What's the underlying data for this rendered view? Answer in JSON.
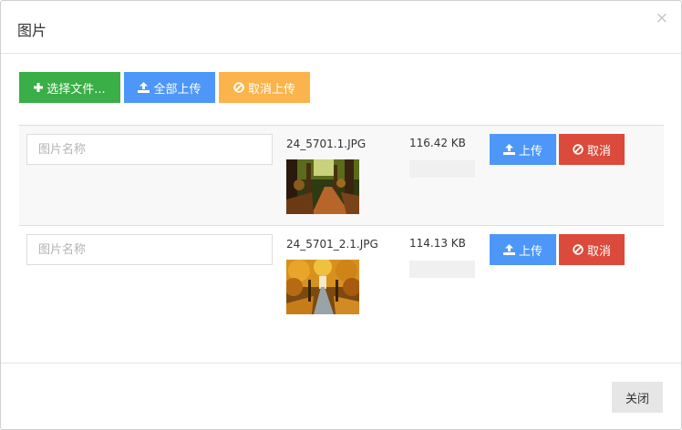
{
  "dialog": {
    "title": "图片",
    "close_symbol": "×"
  },
  "toolbar": {
    "select_files": {
      "label": "选择文件...",
      "icon": "plus-icon"
    },
    "upload_all": {
      "label": "全部上传",
      "icon": "upload-icon"
    },
    "cancel_upload": {
      "label": "取消上传",
      "icon": "ban-icon"
    }
  },
  "files": [
    {
      "name_placeholder": "图片名称",
      "filename": "24_5701.1.JPG",
      "size": "116.42 KB",
      "progress": 0,
      "upload_label": "上传",
      "cancel_label": "取消"
    },
    {
      "name_placeholder": "图片名称",
      "filename": "24_5701_2.1.JPG",
      "size": "114.13 KB",
      "progress": 0,
      "upload_label": "上传",
      "cancel_label": "取消"
    }
  ],
  "footer": {
    "close_label": "关闭"
  },
  "colors": {
    "green": "#3aae47",
    "blue": "#4d97f8",
    "orange": "#fbb44b",
    "red": "#db4a3a"
  }
}
